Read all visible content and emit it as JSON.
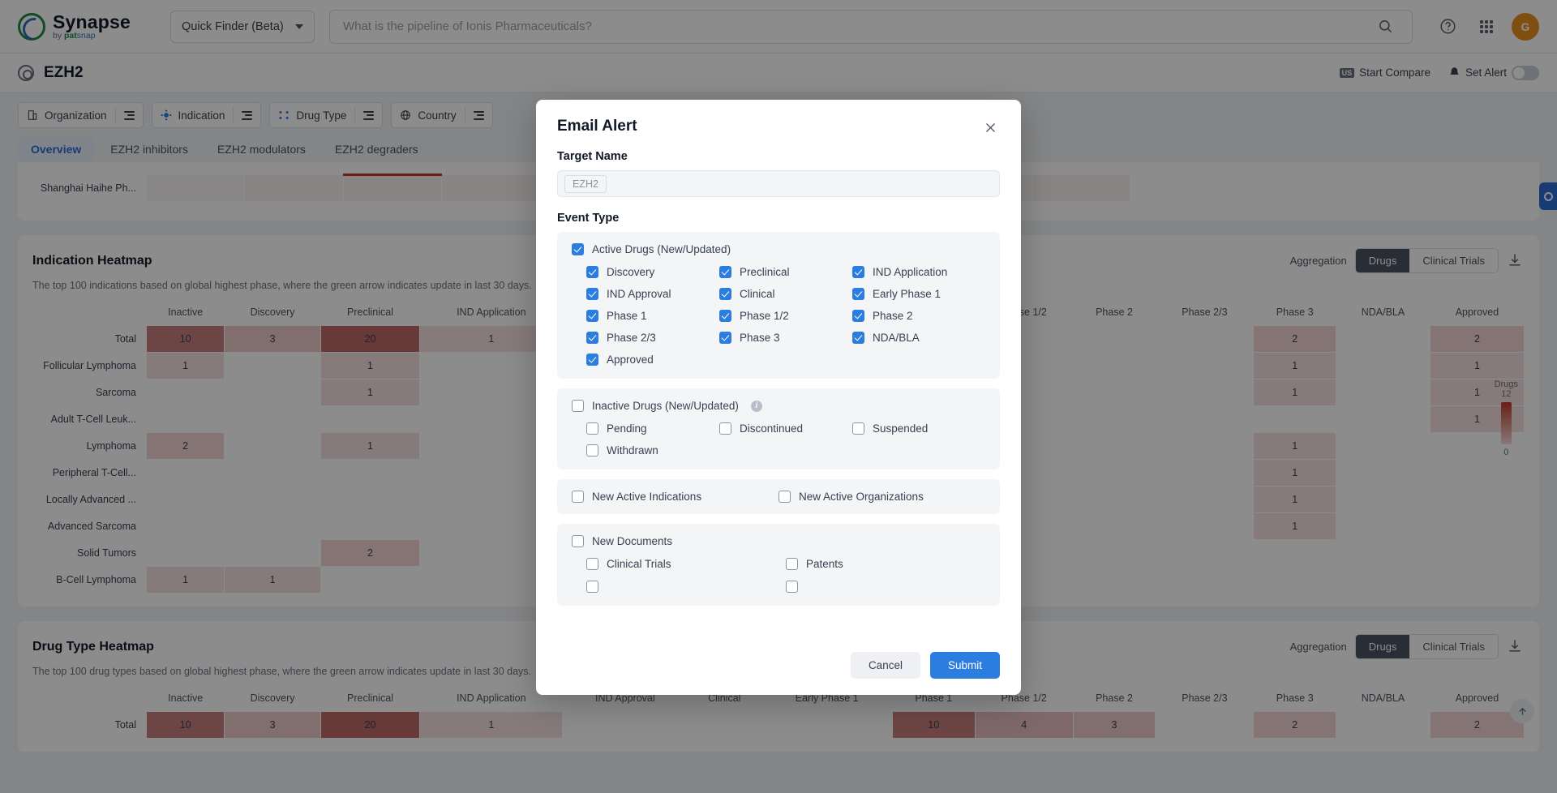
{
  "topbar": {
    "brand_name": "Synapse",
    "brand_by": "by ",
    "brand_pat": "pat",
    "brand_snap": "snap",
    "finder_label": "Quick Finder (Beta)",
    "search_placeholder": "What is the pipeline of Ionis Pharmaceuticals?",
    "avatar_initial": "G",
    "accent_blue": "#2b7de0"
  },
  "target_header": {
    "name": "EZH2",
    "start_compare": "Start Compare",
    "us_badge": "US",
    "set_alert": "Set Alert"
  },
  "filters": [
    {
      "label": "Organization",
      "icon": "building-icon"
    },
    {
      "label": "Indication",
      "icon": "virus-icon"
    },
    {
      "label": "Drug Type",
      "icon": "molecule-icon"
    },
    {
      "label": "Country",
      "icon": "globe-icon"
    }
  ],
  "tabs": [
    {
      "label": "Overview",
      "active": true
    },
    {
      "label": "EZH2 inhibitors",
      "active": false
    },
    {
      "label": "EZH2 modulators",
      "active": false
    },
    {
      "label": "EZH2 degraders",
      "active": false
    }
  ],
  "partial_row": {
    "label": "Shanghai Haihe Ph..."
  },
  "indication_panel": {
    "title": "Indication Heatmap",
    "subtitle": "The top 100 indications based on global highest phase, where the green arrow indicates update in last 30 days.",
    "aggregation_label": "Aggregation",
    "seg_drugs": "Drugs",
    "seg_trials": "Clinical Trials",
    "legend_title": "Drugs",
    "legend_max": "12",
    "legend_min": "0"
  },
  "drugtype_panel": {
    "title": "Drug Type Heatmap",
    "subtitle": "The top 100 drug types based on global highest phase, where the green arrow indicates update in last 30 days.",
    "aggregation_label": "Aggregation",
    "seg_drugs": "Drugs",
    "seg_trials": "Clinical Trials"
  },
  "heatmap_columns": [
    "Inactive",
    "Discovery",
    "Preclinical",
    "IND Application",
    "IND Approval",
    "Clinical",
    "Early Phase 1",
    "Phase 1",
    "Phase 1/2",
    "Phase 2",
    "Phase 2/3",
    "Phase 3",
    "NDA/BLA",
    "Approved"
  ],
  "indication_rows": [
    {
      "label": "Total",
      "cells": [
        "10",
        "3",
        "20",
        "1",
        "",
        "",
        "",
        "",
        "",
        "",
        "",
        "2",
        "",
        "2"
      ]
    },
    {
      "label": "Follicular Lymphoma",
      "cells": [
        "1",
        "",
        "1",
        "",
        "",
        "",
        "",
        "",
        "",
        "",
        "",
        "1",
        "",
        "1"
      ]
    },
    {
      "label": "Sarcoma",
      "cells": [
        "",
        "",
        "1",
        "",
        "",
        "",
        "",
        "",
        "",
        "",
        "",
        "1",
        "",
        "1"
      ]
    },
    {
      "label": "Adult T-Cell Leuk...",
      "cells": [
        "",
        "",
        "",
        "",
        "",
        "",
        "",
        "",
        "",
        "",
        "",
        "",
        "",
        "1"
      ]
    },
    {
      "label": "Lymphoma",
      "cells": [
        "2",
        "",
        "1",
        "",
        "",
        "",
        "",
        "",
        "",
        "",
        "",
        "1",
        "",
        ""
      ]
    },
    {
      "label": "Peripheral T-Cell...",
      "cells": [
        "",
        "",
        "",
        "",
        "",
        "",
        "",
        "",
        "",
        "",
        "",
        "1",
        "",
        ""
      ]
    },
    {
      "label": "Locally Advanced ...",
      "cells": [
        "",
        "",
        "",
        "",
        "",
        "",
        "",
        "",
        "",
        "",
        "",
        "1",
        "",
        ""
      ]
    },
    {
      "label": "Advanced Sarcoma",
      "cells": [
        "",
        "",
        "",
        "",
        "",
        "",
        "",
        "",
        "",
        "",
        "",
        "1",
        "",
        ""
      ]
    },
    {
      "label": "Solid Tumors",
      "cells": [
        "",
        "",
        "2",
        "",
        "",
        "",
        "",
        "",
        "",
        "",
        "",
        "",
        "",
        ""
      ]
    },
    {
      "label": "B-Cell Lymphoma",
      "cells": [
        "1",
        "1",
        "",
        "",
        "",
        "",
        "",
        "",
        "",
        "",
        "",
        "",
        "",
        ""
      ]
    }
  ],
  "drugtype_rows": [
    {
      "label": "Total",
      "cells": [
        "10",
        "3",
        "20",
        "1",
        "",
        "",
        "",
        "10",
        "4",
        "3",
        "",
        "2",
        "",
        "2"
      ]
    }
  ],
  "modal": {
    "title": "Email Alert",
    "close_icon": "close-icon",
    "target_name_label": "Target Name",
    "target_name_value": "EZH2",
    "event_type_label": "Event Type",
    "groups": [
      {
        "id": "active-drugs",
        "parent": {
          "label": "Active Drugs (New/Updated)",
          "checked": true,
          "info": false
        },
        "children": [
          {
            "label": "Discovery",
            "checked": true
          },
          {
            "label": "Preclinical",
            "checked": true
          },
          {
            "label": "IND Application",
            "checked": true
          },
          {
            "label": "IND Approval",
            "checked": true
          },
          {
            "label": "Clinical",
            "checked": true
          },
          {
            "label": "Early Phase 1",
            "checked": true
          },
          {
            "label": "Phase 1",
            "checked": true
          },
          {
            "label": "Phase 1/2",
            "checked": true
          },
          {
            "label": "Phase 2",
            "checked": true
          },
          {
            "label": "Phase 2/3",
            "checked": true
          },
          {
            "label": "Phase 3",
            "checked": true
          },
          {
            "label": "NDA/BLA",
            "checked": true
          },
          {
            "label": "Approved",
            "checked": true
          }
        ]
      },
      {
        "id": "inactive-drugs",
        "parent": {
          "label": "Inactive Drugs (New/Updated)",
          "checked": false,
          "info": true
        },
        "children": [
          {
            "label": "Pending",
            "checked": false
          },
          {
            "label": "Discontinued",
            "checked": false
          },
          {
            "label": "Suspended",
            "checked": false
          },
          {
            "label": "Withdrawn",
            "checked": false
          }
        ]
      }
    ],
    "flat_group": [
      {
        "label": "New Active Indications",
        "checked": false
      },
      {
        "label": "New Active Organizations",
        "checked": false
      }
    ],
    "documents_group": {
      "parent": {
        "label": "New Documents",
        "checked": false
      },
      "children": [
        {
          "label": "Clinical Trials",
          "checked": false
        },
        {
          "label": "Patents",
          "checked": false
        }
      ]
    },
    "cancel_label": "Cancel",
    "submit_label": "Submit"
  }
}
